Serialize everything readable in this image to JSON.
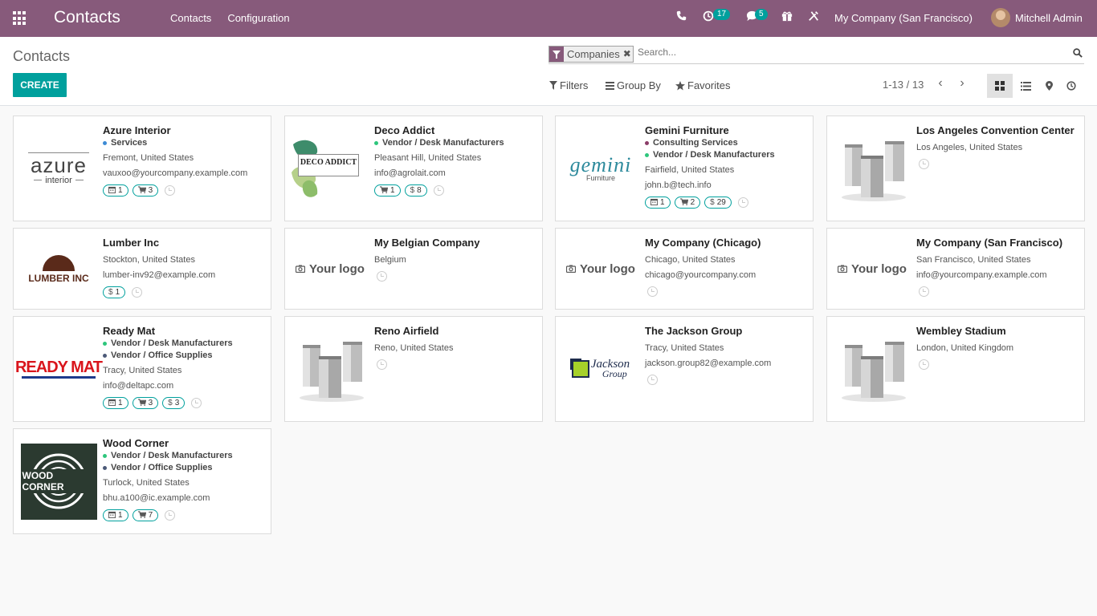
{
  "navbar": {
    "app_title": "Contacts",
    "menu": [
      "Contacts",
      "Configuration"
    ],
    "activity_count": "17",
    "message_count": "5",
    "company": "My Company (San Francisco)",
    "user": "Mitchell Admin",
    "icons": [
      "apps-icon",
      "phone-icon",
      "clock-icon",
      "chat-icon",
      "gift-icon",
      "tools-icon"
    ]
  },
  "control": {
    "breadcrumb": "Contacts",
    "create_label": "CREATE",
    "facet_label": "Companies",
    "search_placeholder": "Search...",
    "filters_label": "Filters",
    "groupby_label": "Group By",
    "favorites_label": "Favorites",
    "pager": "1-13 / 13",
    "views": [
      "kanban",
      "list",
      "map",
      "activity"
    ],
    "active_view": "kanban"
  },
  "colors": {
    "brand": "#875a7b",
    "accent": "#00a09d",
    "tag_green": "#2ec67c",
    "tag_navy": "#4c5a78",
    "tag_purple": "#8b3d68"
  },
  "cards": [
    {
      "name": "Azure Interior",
      "tags": [
        {
          "label": "Services",
          "color": "#3d8bd5"
        }
      ],
      "lines": [
        "Fremont, United States",
        "vauxoo@yourcompany.example.com"
      ],
      "badges": [
        {
          "icon": "calendar-icon",
          "text": "1"
        },
        {
          "icon": "cart-icon",
          "text": "3"
        }
      ],
      "logo": "azure"
    },
    {
      "name": "Deco Addict",
      "tags": [
        {
          "label": "Vendor / Desk Manufacturers",
          "color": "#2ec67c"
        }
      ],
      "lines": [
        "Pleasant Hill, United States",
        "info@agrolait.com"
      ],
      "badges": [
        {
          "icon": "cart-icon",
          "text": "1"
        },
        {
          "icon": "dollar-icon",
          "text": "8"
        }
      ],
      "logo": "deco"
    },
    {
      "name": "Gemini Furniture",
      "tags": [
        {
          "label": "Consulting Services",
          "color": "#8b3d68"
        },
        {
          "label": "Vendor / Desk Manufacturers",
          "color": "#2ec67c"
        }
      ],
      "lines": [
        "Fairfield, United States",
        "john.b@tech.info"
      ],
      "badges": [
        {
          "icon": "calendar-icon",
          "text": "1"
        },
        {
          "icon": "cart-icon",
          "text": "2"
        },
        {
          "icon": "dollar-icon",
          "text": "29"
        }
      ],
      "logo": "gemini"
    },
    {
      "name": "Los Angeles Convention Center",
      "tags": [],
      "lines": [
        "Los Angeles, United States"
      ],
      "badges": [],
      "logo": "building"
    },
    {
      "name": "Lumber Inc",
      "tags": [],
      "lines": [
        "Stockton, United States",
        "lumber-inv92@example.com"
      ],
      "badges": [
        {
          "icon": "dollar-icon",
          "text": "1"
        }
      ],
      "logo": "lumber"
    },
    {
      "name": "My Belgian Company",
      "tags": [],
      "lines": [
        "Belgium"
      ],
      "badges": [],
      "logo": "yourlogo"
    },
    {
      "name": "My Company (Chicago)",
      "tags": [],
      "lines": [
        "Chicago, United States",
        "chicago@yourcompany.com"
      ],
      "badges": [],
      "logo": "yourlogo"
    },
    {
      "name": "My Company (San Francisco)",
      "tags": [],
      "lines": [
        "San Francisco, United States",
        "info@yourcompany.example.com"
      ],
      "badges": [],
      "logo": "yourlogo"
    },
    {
      "name": "Ready Mat",
      "tags": [
        {
          "label": "Vendor / Desk Manufacturers",
          "color": "#2ec67c"
        },
        {
          "label": "Vendor / Office Supplies",
          "color": "#4c5a78"
        }
      ],
      "lines": [
        "Tracy, United States",
        "info@deltapc.com"
      ],
      "badges": [
        {
          "icon": "calendar-icon",
          "text": "1"
        },
        {
          "icon": "cart-icon",
          "text": "3"
        },
        {
          "icon": "dollar-icon",
          "text": "3"
        }
      ],
      "logo": "readymat"
    },
    {
      "name": "Reno Airfield",
      "tags": [],
      "lines": [
        "Reno, United States"
      ],
      "badges": [],
      "logo": "building"
    },
    {
      "name": "The Jackson Group",
      "tags": [],
      "lines": [
        "Tracy, United States",
        "jackson.group82@example.com"
      ],
      "badges": [],
      "logo": "jackson"
    },
    {
      "name": "Wembley Stadium",
      "tags": [],
      "lines": [
        "London, United Kingdom"
      ],
      "badges": [],
      "logo": "building"
    },
    {
      "name": "Wood Corner",
      "tags": [
        {
          "label": "Vendor / Desk Manufacturers",
          "color": "#2ec67c"
        },
        {
          "label": "Vendor / Office Supplies",
          "color": "#4c5a78"
        }
      ],
      "lines": [
        "Turlock, United States",
        "bhu.a100@ic.example.com"
      ],
      "badges": [
        {
          "icon": "calendar-icon",
          "text": "1"
        },
        {
          "icon": "cart-icon",
          "text": "7"
        }
      ],
      "logo": "woodcorner"
    }
  ],
  "logos": {
    "azure_word": "azure",
    "azure_sub": "interior",
    "deco": "DECO ADDICT",
    "gemini_word": "gemini",
    "gemini_sub": "Furniture",
    "lumber": "LUMBER INC",
    "yourlogo": "Your logo",
    "readymat": "READY MAT",
    "jackson_word": "Jackson",
    "jackson_sub": "Group",
    "woodcorner": "WOOD CORNER"
  }
}
